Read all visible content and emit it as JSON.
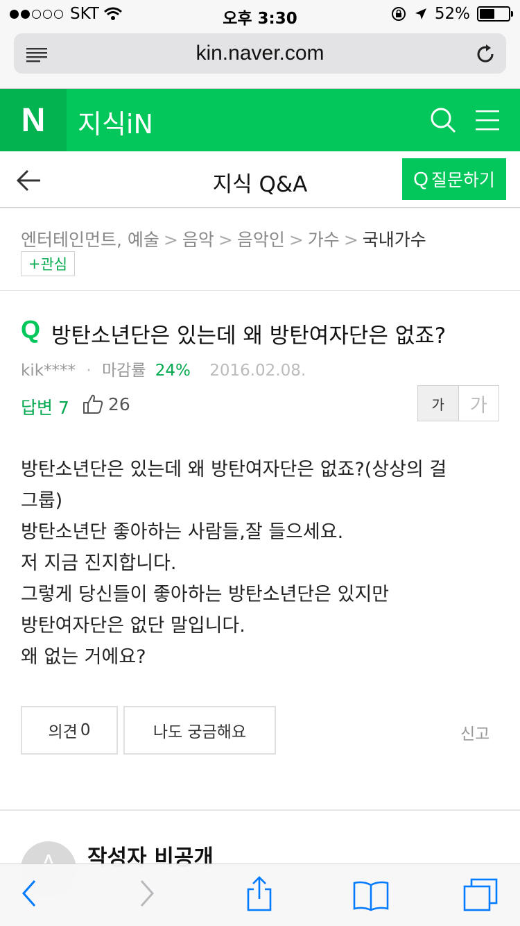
{
  "status_bar": {
    "carrier": "SKT",
    "time": "오후 3:30",
    "battery": "52%",
    "battery_level": 0.52
  },
  "browser": {
    "url": "kin.naver.com",
    "icons": [
      "reader-icon",
      "reload-icon"
    ]
  },
  "naver_header": {
    "logo": "N",
    "service": "지식iN",
    "icons": [
      "search-icon",
      "menu-icon"
    ]
  },
  "sub_header": {
    "title": "지식 Q&A",
    "ask_button": "질문하기",
    "ask_icon": "Q"
  },
  "breadcrumb": {
    "items": [
      "엔터테인먼트, 예술",
      "음악",
      "음악인",
      "가수",
      "국내가수"
    ],
    "separator": ">",
    "follow_label": "관심",
    "follow_plus": "+"
  },
  "question": {
    "mark": "Q",
    "title": "방탄소년단은 있는데 왜 방탄여자단은 없죠?",
    "author": "kik****",
    "dot": "·",
    "close_rate_label": "마감률",
    "close_rate": "24%",
    "date": "2016.02.08.",
    "answers_label": "답변",
    "answers_count": "7",
    "likes": "26",
    "font_small": "가",
    "font_large": "가",
    "body": [
      "방탄소년단은 있는데 왜 방탄여자단은 없죠?(상상의 걸",
      "그룹)",
      "방탄소년단 좋아하는 사람들,잘 들으세요.",
      "저 지금 진지합니다.",
      "그렇게 당신들이 좋아하는 방탄소년단은 있지만",
      "방탄여자단은 없단 말입니다.",
      "왜 없는 거에요?"
    ],
    "opinion_label": "의견",
    "opinion_count": "0",
    "curious_label": "나도 궁금해요",
    "report_label": "신고"
  },
  "answer": {
    "author": "작성자 비공개",
    "avatar_letter": "A"
  },
  "colors": {
    "naver_green": "#03c75a",
    "naver_green_dark": "#02b34f",
    "accent_text": "#03a94e",
    "ios_blue": "#007aff"
  }
}
